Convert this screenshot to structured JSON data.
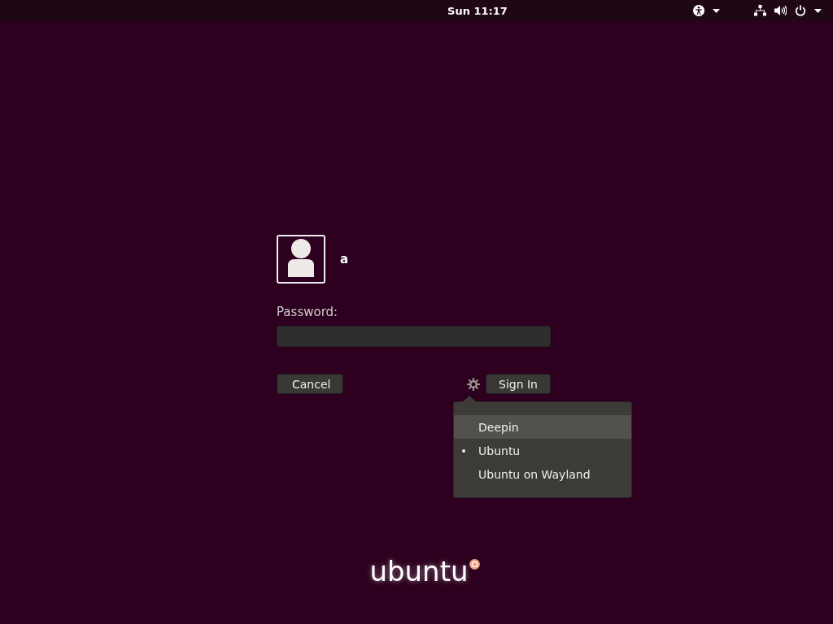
{
  "top_bar": {
    "clock": "Sun 11:17"
  },
  "user": {
    "name": "a"
  },
  "password": {
    "label": "Password:"
  },
  "buttons": {
    "cancel": "Cancel",
    "sign_in": "Sign In"
  },
  "session_menu": [
    {
      "label": "Deepin",
      "selected": false,
      "highlighted": true
    },
    {
      "label": "Ubuntu",
      "selected": true,
      "highlighted": false
    },
    {
      "label": "Ubuntu on Wayland",
      "selected": false,
      "highlighted": false
    }
  ],
  "logo": "ubuntu"
}
